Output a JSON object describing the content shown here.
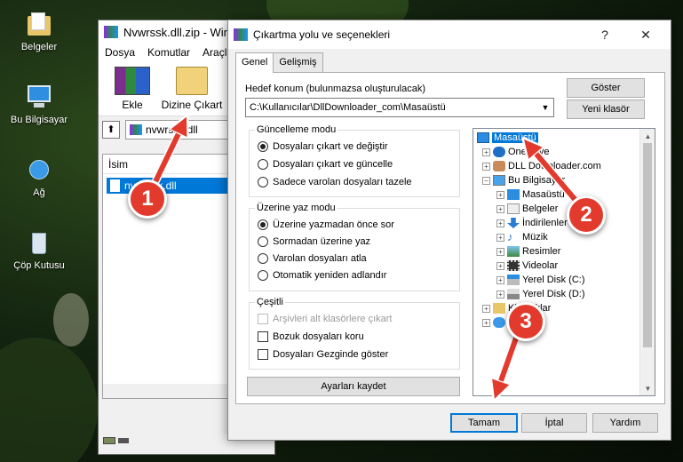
{
  "desktop": {
    "icons": [
      {
        "label": "Belgeler",
        "icon": "folder-icon"
      },
      {
        "label": "Bu Bilgisayar",
        "icon": "computer-icon"
      },
      {
        "label": "Ağ",
        "icon": "network-icon"
      },
      {
        "label": "Çöp Kutusu",
        "icon": "recycle-bin-icon"
      }
    ]
  },
  "winrar": {
    "title": "Nvwrssk.dll.zip - WinRAR",
    "menu": [
      "Dosya",
      "Komutlar",
      "Araçlar"
    ],
    "toolbar": {
      "add": "Ekle",
      "extract": "Dizine Çıkart"
    },
    "path": "nvwrssk.dll",
    "column_name": "İsim",
    "file": "nvwrssk.dll"
  },
  "dialog": {
    "title": "Çıkartma yolu ve seçenekleri",
    "tabs": [
      "Genel",
      "Gelişmiş"
    ],
    "dest_label": "Hedef konum (bulunmazsa oluşturulacak)",
    "dest_value": "C:\\Kullanıcılar\\DllDownloader_com\\Masaüstü",
    "show_button": "Göster",
    "new_folder_button": "Yeni klasör",
    "update_mode": {
      "title": "Güncelleme modu",
      "options": [
        "Dosyaları çıkart ve değiştir",
        "Dosyaları çıkart ve güncelle",
        "Sadece varolan dosyaları tazele"
      ],
      "selected": 0
    },
    "overwrite_mode": {
      "title": "Üzerine yaz modu",
      "options": [
        "Üzerine yazmadan önce sor",
        "Sormadan üzerine yaz",
        "Varolan dosyaları atla",
        "Otomatik yeniden adlandır"
      ],
      "selected": 0
    },
    "misc": {
      "title": "Çeşitli",
      "options": [
        "Arşivleri alt klasörlere çıkart",
        "Bozuk dosyaları koru",
        "Dosyaları Gezginde göster"
      ]
    },
    "save_settings": "Ayarları kaydet",
    "tree": {
      "root": "Masaüstü",
      "level1": [
        "OneDrive",
        "DLL Downloader.com",
        "Bu Bilgisayar"
      ],
      "level2": [
        "Masaüstü",
        "Belgeler",
        "İndirilenler",
        "Müzik",
        "Resimler",
        "Videolar",
        "Yerel Disk (C:)",
        "Yerel Disk (D:)"
      ],
      "level1b": [
        "Kitaplıklar",
        "Ağ"
      ]
    },
    "ok": "Tamam",
    "cancel": "İptal",
    "help": "Yardım"
  },
  "steps": [
    "1",
    "2",
    "3"
  ],
  "colors": {
    "selection": "#0078d7",
    "badge": "#e23b2e"
  }
}
